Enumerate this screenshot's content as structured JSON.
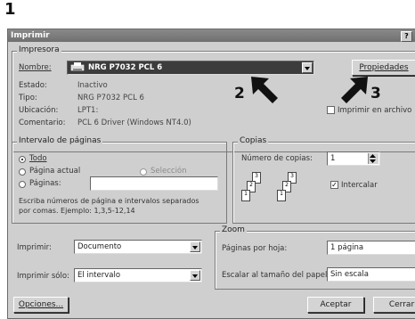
{
  "step_number": "1",
  "annotations": {
    "arrow2": "2",
    "arrow3": "3"
  },
  "window": {
    "title": "Imprimir",
    "help": "?"
  },
  "printer": {
    "group_label": "Impresora",
    "name_label": "Nombre:",
    "name_value": "NRG P7032 PCL 6",
    "status_label": "Estado:",
    "status_value": "Inactivo",
    "type_label": "Tipo:",
    "type_value": "NRG P7032 PCL 6",
    "location_label": "Ubicación:",
    "location_value": "LPT1:",
    "comment_label": "Comentario:",
    "comment_value": "PCL 6 Driver (Windows NT4.0)",
    "properties_button": "Propiedades",
    "print_to_file_label": "Imprimir en archivo"
  },
  "page_range": {
    "group_label": "Intervalo de páginas",
    "all_label": "Todo",
    "current_page_label": "Página actual",
    "selection_label": "Selección",
    "pages_label": "Páginas:",
    "pages_value": "",
    "hint_line1": "Escriba números de página e intervalos separados",
    "hint_line2": "por comas. Ejemplo: 1,3,5-12,14",
    "selected": "all"
  },
  "copies": {
    "group_label": "Copias",
    "number_label": "Número de copias:",
    "number_value": "1",
    "collate_label": "Intercalar",
    "collate_checked": true
  },
  "print_what": {
    "label": "Imprimir:",
    "value": "Documento"
  },
  "print_only": {
    "label": "Imprimir sólo:",
    "value": "El intervalo"
  },
  "zoom": {
    "group_label": "Zoom",
    "pages_per_sheet_label": "Páginas por hoja:",
    "pages_per_sheet_value": "1 página",
    "scale_label": "Escalar al tamaño del papel:",
    "scale_value": "Sin escala"
  },
  "buttons": {
    "options": "Opciones...",
    "ok": "Aceptar",
    "close": "Cerrar"
  },
  "colors": {
    "dialog_bg": "#cfcfcf",
    "titlebar": "#7a7a7a",
    "printer_field_bg": "#3a3a3a"
  }
}
